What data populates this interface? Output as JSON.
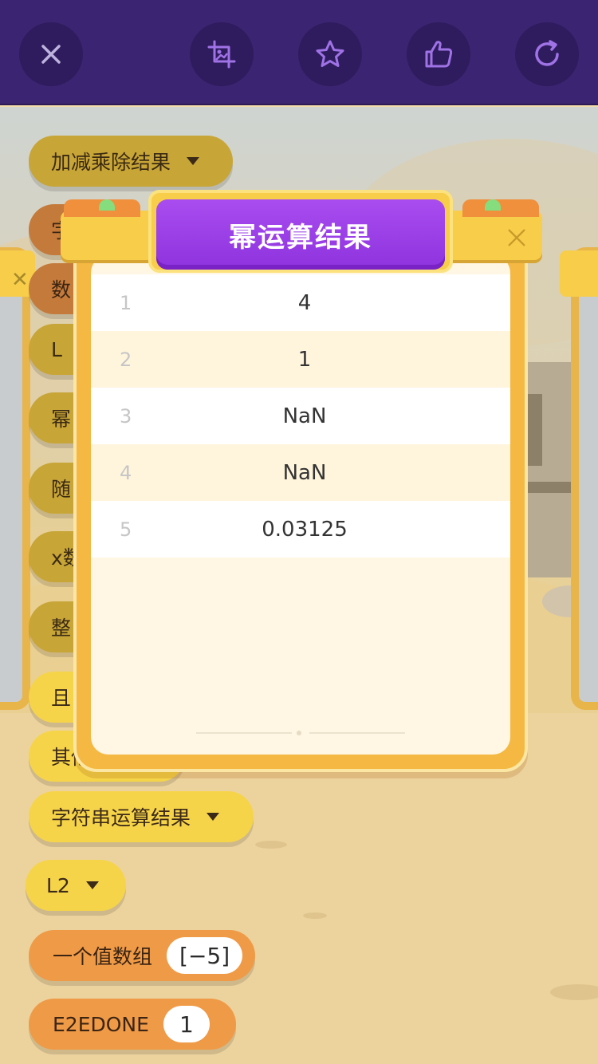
{
  "toolbar": {
    "close_icon": "close-icon",
    "screenshot_icon": "screenshot-icon",
    "star_icon": "star-icon",
    "like_icon": "thumbs-up-icon",
    "refresh_icon": "refresh-icon"
  },
  "blocks": {
    "arith_result": "加减乘除结果",
    "b2": "字",
    "b3": "数",
    "b4": "L",
    "b5": "幂",
    "b6": "随",
    "b7": "x数",
    "b8": "整",
    "b9": "且",
    "b10": "其他",
    "string_result": "字符串运算结果",
    "l2": "L2",
    "single_array_label": "一个值数组",
    "single_array_value": "[−5]",
    "e2edone_label": "E2EDONE",
    "e2edone_value": "1"
  },
  "dialog": {
    "title": "幂运算结果",
    "rows": [
      {
        "index": "1",
        "value": "4"
      },
      {
        "index": "2",
        "value": "1"
      },
      {
        "index": "3",
        "value": "NaN"
      },
      {
        "index": "4",
        "value": "NaN"
      },
      {
        "index": "5",
        "value": "0.03125"
      }
    ]
  },
  "colors": {
    "topbar": "#3b2471",
    "title_pill": "#9a3fe6",
    "frame": "#f5b842",
    "accent_green": "#86dd7d"
  }
}
